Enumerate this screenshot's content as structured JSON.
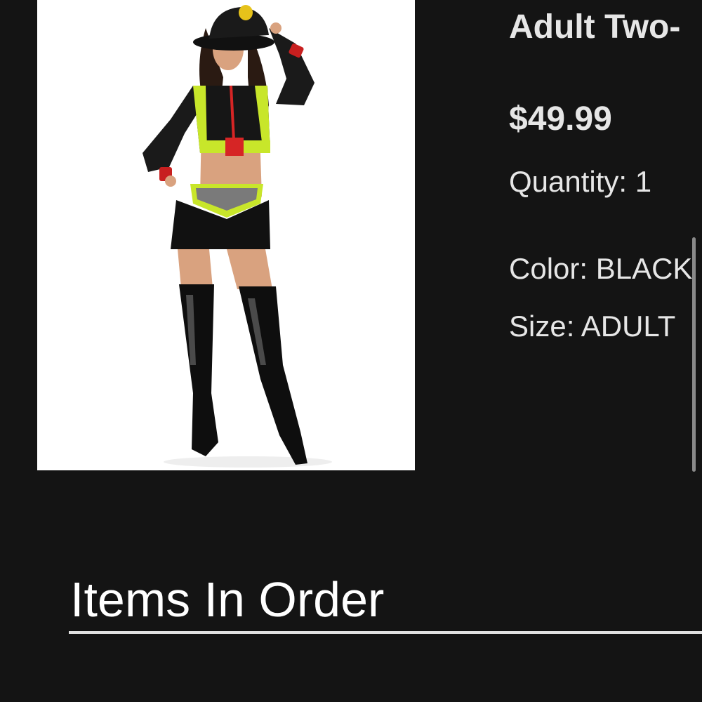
{
  "order_item": {
    "title": "Adult Two-",
    "price": "$49.99",
    "quantity": "Quantity: 1",
    "color": "Color: BLACK",
    "size": "Size: ADULT",
    "image_alt": "product-photo-firefighter-costume"
  },
  "items_section": {
    "heading": "Items In Order"
  },
  "colors": {
    "background": "#141414",
    "text": "#e6e6e6",
    "heading": "#ffffff"
  }
}
